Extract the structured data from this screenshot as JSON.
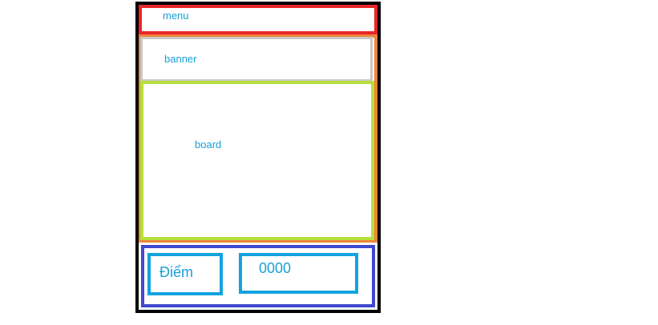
{
  "layout_blocks": {
    "menu_label": "menu",
    "banner_label": "banner",
    "board_label": "board"
  },
  "score": {
    "label": "Điểm",
    "value": "0000"
  },
  "colors": {
    "outer_frame": "#000000",
    "menu_border": "#e8262a",
    "banner_board_frame": "#f0843c",
    "banner_border": "#c8c8c8",
    "board_border": "#b5e03a",
    "score_area_border": "#3f48cc",
    "score_field_border": "#12a3e0",
    "label_text": "#1aa0d8"
  }
}
